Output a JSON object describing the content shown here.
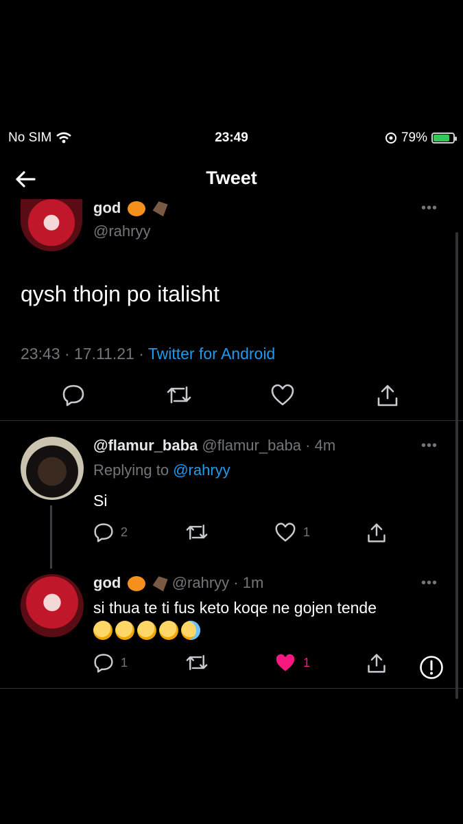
{
  "status_bar": {
    "carrier": "No SIM",
    "time": "23:49",
    "battery_percent": "79%",
    "battery_level": 0.79
  },
  "header": {
    "title": "Tweet"
  },
  "main_tweet": {
    "display_name": "god",
    "handle": "@rahryy",
    "text": "qysh thojn po italisht",
    "timestamp": "23:43 · 17.11.21 ·",
    "source": "Twitter for Android"
  },
  "replies": [
    {
      "display_name": "@flamur_baba",
      "handle_time": "@flamur_baba · 4m",
      "replying_prefix": "Replying to",
      "replying_to": "@rahryy",
      "text": "Si",
      "reply_count": "2",
      "like_count": "1"
    },
    {
      "display_name": "god",
      "handle_time": "@rahryy · 1m",
      "text": "si thua te ti fus keto koqe ne gojen tende",
      "reply_count": "1",
      "like_count": "1",
      "liked": true,
      "like_color": "#f91880"
    }
  ],
  "colors": {
    "accent": "#1d9bf0",
    "background": "#000000",
    "muted": "#71767b"
  }
}
